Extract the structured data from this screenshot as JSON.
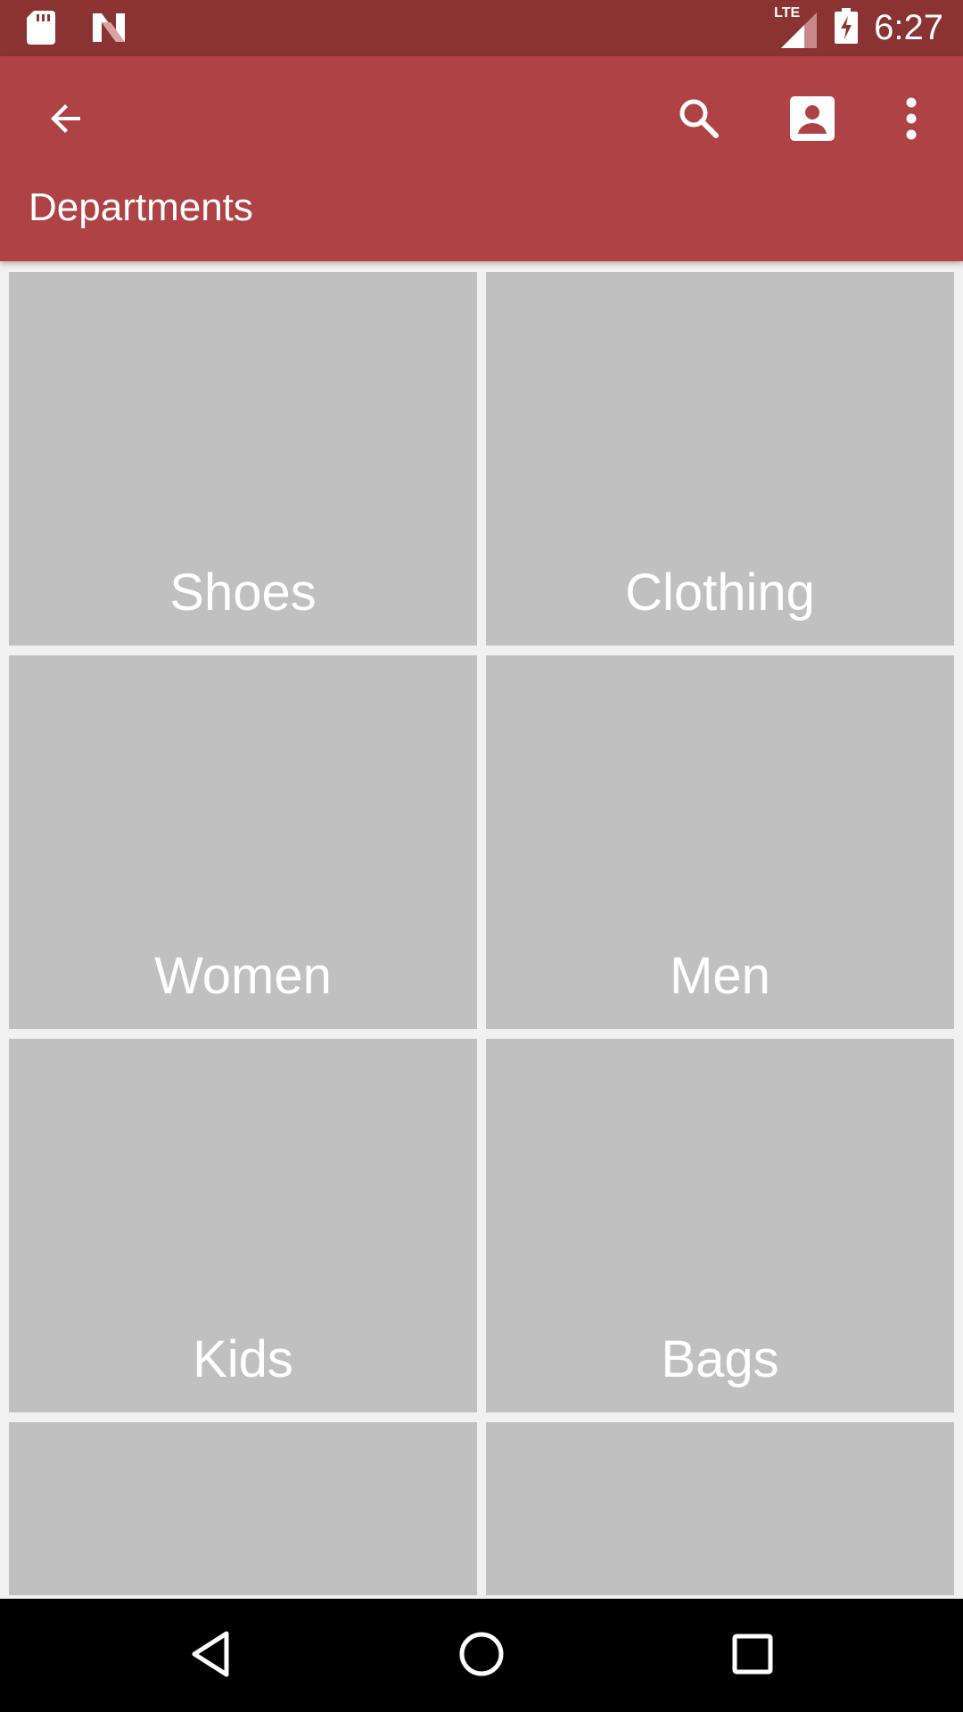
{
  "status_bar": {
    "time": "6:27",
    "network_label": "LTE",
    "icons": [
      "sd-card-icon",
      "n-notification-icon",
      "lte-signal-icon",
      "battery-charging-icon"
    ]
  },
  "app_bar": {
    "title": "Departments",
    "background_color": "#ae4244",
    "status_color": "#8b3333",
    "actions": [
      "back-arrow-icon",
      "search-icon",
      "account-box-icon",
      "more-vert-icon"
    ]
  },
  "departments": [
    {
      "label": "Shoes"
    },
    {
      "label": "Clothing"
    },
    {
      "label": "Women"
    },
    {
      "label": "Men"
    },
    {
      "label": "Kids"
    },
    {
      "label": "Bags"
    },
    {
      "label": ""
    },
    {
      "label": ""
    }
  ],
  "tile_color": "#c0c0c0",
  "nav_bar": {
    "buttons": [
      "nav-back-icon",
      "nav-home-icon",
      "nav-recents-icon"
    ]
  }
}
